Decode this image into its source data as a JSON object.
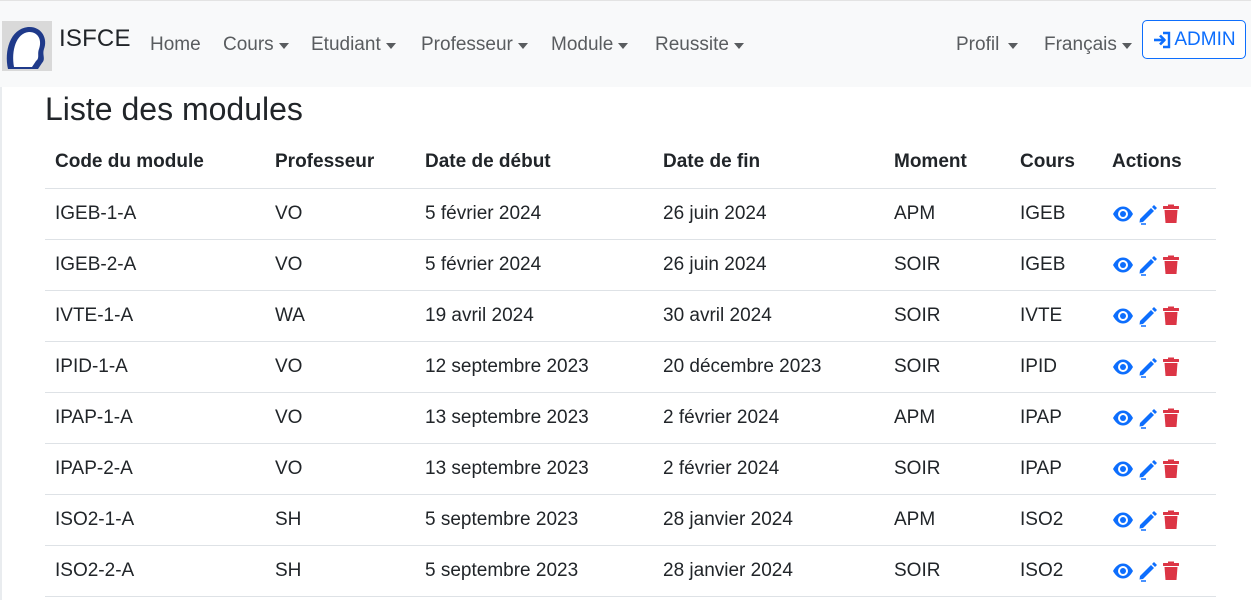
{
  "navbar": {
    "brand": "ISFCE",
    "items": [
      {
        "label": "Home",
        "dropdown": false
      },
      {
        "label": "Cours",
        "dropdown": true
      },
      {
        "label": "Etudiant",
        "dropdown": true
      },
      {
        "label": "Professeur",
        "dropdown": true
      },
      {
        "label": "Module",
        "dropdown": true
      },
      {
        "label": "Reussite",
        "dropdown": true
      }
    ],
    "profile_label": "Profil",
    "language_label": "Français",
    "admin_label": "ADMIN"
  },
  "page": {
    "title": "Liste des modules"
  },
  "table": {
    "headers": [
      "Code du module",
      "Professeur",
      "Date de début",
      "Date de fin",
      "Moment",
      "Cours",
      "Actions"
    ],
    "rows": [
      [
        "IGEB-1-A",
        "VO",
        "5 février 2024",
        "26 juin 2024",
        "APM",
        "IGEB"
      ],
      [
        "IGEB-2-A",
        "VO",
        "5 février 2024",
        "26 juin 2024",
        "SOIR",
        "IGEB"
      ],
      [
        "IVTE-1-A",
        "WA",
        "19 avril 2024",
        "30 avril 2024",
        "SOIR",
        "IVTE"
      ],
      [
        "IPID-1-A",
        "VO",
        "12 septembre 2023",
        "20 décembre 2023",
        "SOIR",
        "IPID"
      ],
      [
        "IPAP-1-A",
        "VO",
        "13 septembre 2023",
        "2 février 2024",
        "APM",
        "IPAP"
      ],
      [
        "IPAP-2-A",
        "VO",
        "13 septembre 2023",
        "2 février 2024",
        "SOIR",
        "IPAP"
      ],
      [
        "ISO2-1-A",
        "SH",
        "5 septembre 2023",
        "28 janvier 2024",
        "APM",
        "ISO2"
      ],
      [
        "ISO2-2-A",
        "SH",
        "5 septembre 2023",
        "28 janvier 2024",
        "SOIR",
        "ISO2"
      ]
    ],
    "row_actions": [
      "view-icon",
      "edit-icon",
      "delete-icon"
    ]
  },
  "colors": {
    "primary": "#0d6efd",
    "danger": "#dc3545",
    "navbar_bg": "#f8f9fa",
    "nav_text": "#595c5f"
  }
}
